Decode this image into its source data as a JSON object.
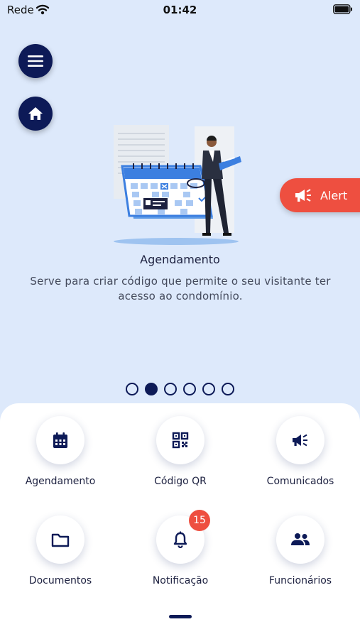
{
  "status_bar": {
    "carrier": "Rede",
    "time": "01:42"
  },
  "alert": {
    "label": "Alert"
  },
  "slide": {
    "title": "Agendamento",
    "description": "Serve para criar código que permite o seu visitante ter acesso ao condomínio.",
    "total": 6,
    "active_index": 1
  },
  "grid": [
    {
      "label": "Agendamento",
      "icon": "calendar-icon"
    },
    {
      "label": "Código QR",
      "icon": "qr-code-icon"
    },
    {
      "label": "Comunicados",
      "icon": "megaphone-icon"
    },
    {
      "label": "Documentos",
      "icon": "folder-icon"
    },
    {
      "label": "Notificação",
      "icon": "bell-icon",
      "badge": "15"
    },
    {
      "label": "Funcionários",
      "icon": "people-icon"
    }
  ],
  "colors": {
    "primary": "#0d1a57",
    "accent": "#ee4f40",
    "background": "#dde9fb"
  }
}
